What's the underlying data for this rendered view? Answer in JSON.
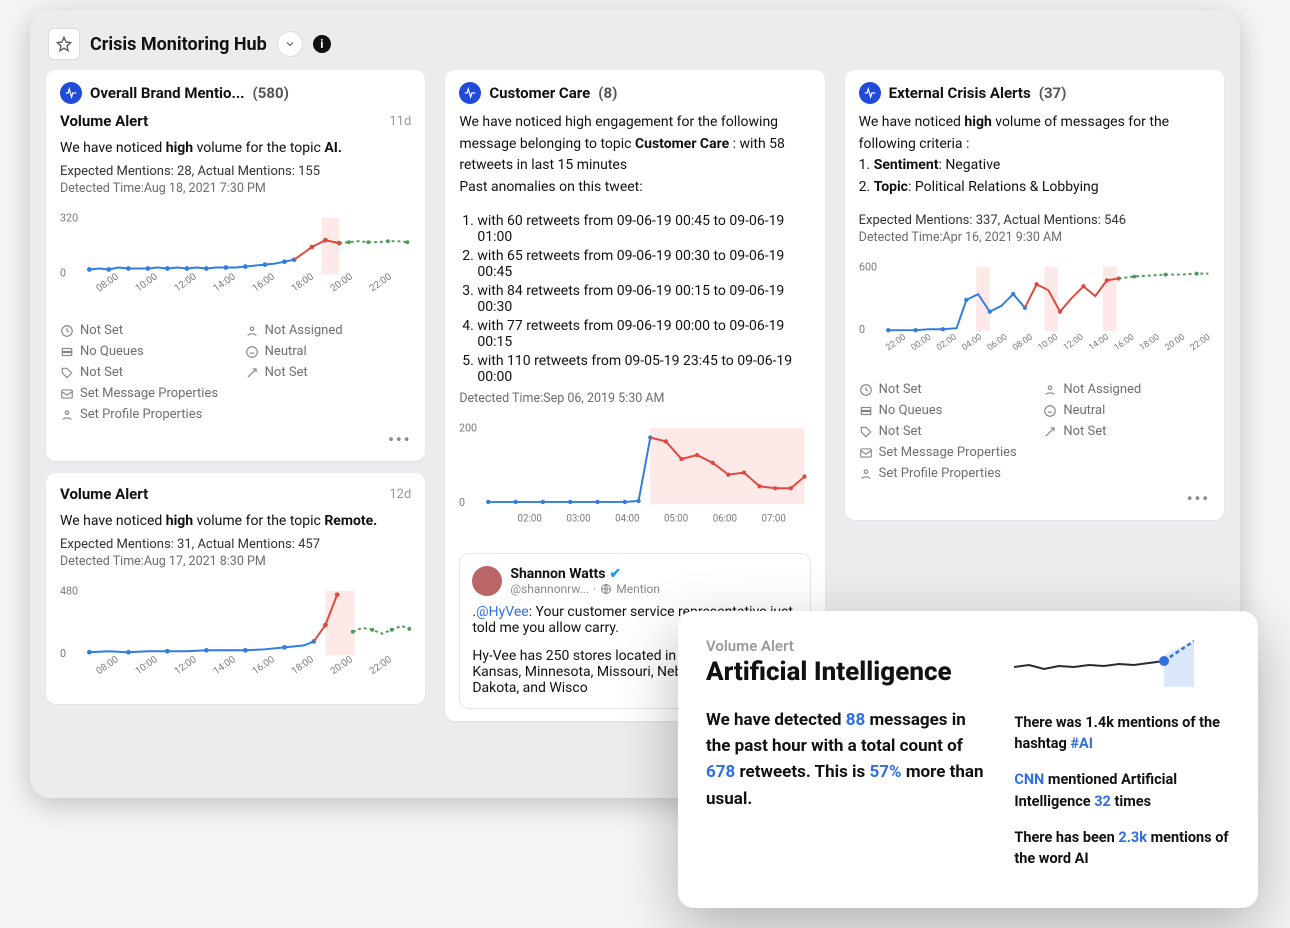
{
  "page": {
    "title": "Crisis Monitoring Hub"
  },
  "columns": {
    "left": {
      "header": {
        "title": "Overall Brand Mentio...",
        "count": "(580)"
      },
      "card1": {
        "title": "Volume Alert",
        "age": "11d",
        "line1_prefix": "We have noticed ",
        "line1_bold1": "high",
        "line1_mid": " volume for the topic ",
        "line1_bold2": "AI.",
        "meta": "Expected Mentions: 28, Actual Mentions: 155",
        "detected": "Detected Time:Aug 18, 2021 7:30 PM"
      },
      "card2": {
        "title": "Volume Alert",
        "age": "12d",
        "line1_prefix": "We have noticed ",
        "line1_bold1": "high",
        "line1_mid": " volume for the topic ",
        "line1_bold2": "Remote.",
        "meta": "Expected Mentions: 31, Actual Mentions: 457",
        "detected": "Detected Time:Aug 17, 2021 8:30 PM"
      }
    },
    "mid": {
      "header": {
        "title": "Customer Care",
        "count": "(8)"
      },
      "intro_prefix": "We have noticed high engagement for the following message belonging to topic ",
      "intro_bold": "Customer Care",
      "intro_suffix": " :  with 58 retweets in last 15 minutes",
      "past_line": "Past anomalies on this tweet:",
      "items": [
        "with 60 retweets from 09-06-19 00:45 to 09-06-19 01:00",
        "with 65 retweets from 09-06-19 00:30 to 09-06-19 00:45",
        "with 84 retweets from 09-06-19 00:15 to 09-06-19 00:30",
        "with 77 retweets from 09-06-19 00:00 to 09-06-19 00:15",
        "with 110 retweets from 09-05-19 23:45 to 09-06-19 00:00"
      ],
      "detected": "Detected Time:Sep 06, 2019 5:30 AM",
      "tweet": {
        "name": "Shannon Watts",
        "handle": "@shannonrw...",
        "source": "Mention",
        "line1_prefix": ".",
        "line1_blue": "@HyVee",
        "line1_suffix": ": Your customer service representative just told me you allow",
        "line1_tail": " carry.",
        "line2": "Hy-Vee has 250 stores located in Iowa, Illinois, Kansas, Minnesota, Missouri, Nebraska, South Dakota, and Wisco"
      }
    },
    "right": {
      "header": {
        "title": "External Crisis Alerts",
        "count": "(37)"
      },
      "intro_prefix": "We have noticed ",
      "intro_bold": "high",
      "intro_suffix": " volume of messages for the following criteria :",
      "crit1_label": "Sentiment",
      "crit1_val": ": Negative",
      "crit2_label": "Topic",
      "crit2_val": ": Political Relations & Lobbying",
      "meta": "Expected Mentions: 337, Actual Mentions: 546",
      "detected": "Detected Time:Apr 16, 2021 9:30 AM"
    }
  },
  "props": {
    "notset": "Not Set",
    "noqueues": "No Queues",
    "notassigned": "Not Assigned",
    "neutral": "Neutral",
    "setmsg": "Set Message Properties",
    "setprof": "Set Profile Properties"
  },
  "chart_data": [
    {
      "id": "left1",
      "type": "line",
      "xlabel": "",
      "ylabel": "",
      "categories_ticks": [
        "08:00",
        "10:00",
        "12:00",
        "14:00",
        "16:00",
        "18:00",
        "20:00",
        "22:00"
      ],
      "x": [
        "07:30",
        "08:00",
        "08:30",
        "09:00",
        "09:30",
        "10:00",
        "10:30",
        "11:00",
        "11:30",
        "12:00",
        "12:30",
        "13:00",
        "13:30",
        "14:00",
        "14:30",
        "15:00",
        "15:30",
        "16:00",
        "16:30",
        "17:00",
        "17:30",
        "18:00",
        "18:30",
        "19:00",
        "19:30",
        "20:00",
        "20:30",
        "21:00",
        "21:30",
        "22:00",
        "22:30",
        "23:00"
      ],
      "series": [
        {
          "name": "actual-low",
          "color": "#2f7de1",
          "style": "solid",
          "values": [
            28,
            30,
            28,
            32,
            30,
            30,
            30,
            32,
            30,
            34,
            32,
            32,
            34,
            30,
            34,
            32,
            34,
            34,
            36,
            40,
            44,
            50,
            null,
            null,
            null,
            null,
            null,
            null,
            null,
            null,
            null,
            null
          ]
        },
        {
          "name": "spike",
          "color": "#e0483e",
          "style": "solid",
          "values": [
            null,
            null,
            null,
            null,
            null,
            null,
            null,
            null,
            null,
            null,
            null,
            null,
            null,
            null,
            null,
            null,
            null,
            null,
            null,
            null,
            null,
            50,
            110,
            155,
            135,
            null,
            null,
            null,
            null,
            null,
            null,
            null
          ]
        },
        {
          "name": "forecast",
          "color": "#4f9a57",
          "style": "dashed",
          "values": [
            null,
            null,
            null,
            null,
            null,
            null,
            null,
            null,
            null,
            null,
            null,
            null,
            null,
            null,
            null,
            null,
            null,
            null,
            null,
            null,
            null,
            null,
            null,
            null,
            135,
            140,
            142,
            140,
            138,
            140,
            142,
            140
          ]
        }
      ],
      "ylim": [
        0,
        320
      ],
      "yticks": [
        0,
        320
      ],
      "shaded_x": [
        "19:00",
        "19:30"
      ]
    },
    {
      "id": "left2",
      "type": "line",
      "categories_ticks": [
        "08:00",
        "10:00",
        "12:00",
        "14:00",
        "16:00",
        "18:00",
        "20:00",
        "22:00"
      ],
      "x": [
        "07:30",
        "08:00",
        "08:30",
        "09:00",
        "09:30",
        "10:00",
        "10:30",
        "11:00",
        "11:30",
        "12:00",
        "12:30",
        "13:00",
        "13:30",
        "14:00",
        "14:30",
        "15:00",
        "15:30",
        "16:00",
        "16:30",
        "17:00",
        "17:30",
        "18:00",
        "18:30",
        "19:00",
        "19:30",
        "20:00",
        "20:30",
        "21:00",
        "21:30",
        "22:00",
        "22:30",
        "23:00"
      ],
      "series": [
        {
          "name": "actual-low",
          "color": "#2f7de1",
          "style": "solid",
          "values": [
            30,
            34,
            30,
            36,
            32,
            34,
            32,
            36,
            34,
            40,
            36,
            36,
            38,
            34,
            40,
            36,
            38,
            36,
            40,
            42,
            48,
            56,
            70,
            null,
            null,
            null,
            null,
            null,
            null,
            null,
            null,
            null
          ]
        },
        {
          "name": "spike",
          "color": "#e0483e",
          "style": "solid",
          "values": [
            null,
            null,
            null,
            null,
            null,
            null,
            null,
            null,
            null,
            null,
            null,
            null,
            null,
            null,
            null,
            null,
            null,
            null,
            null,
            null,
            null,
            null,
            70,
            260,
            457,
            null,
            null,
            null,
            null,
            null,
            null,
            null
          ]
        },
        {
          "name": "forecast",
          "color": "#4f9a57",
          "style": "dashed",
          "values": [
            null,
            null,
            null,
            null,
            null,
            null,
            null,
            null,
            null,
            null,
            null,
            null,
            null,
            null,
            null,
            null,
            null,
            null,
            null,
            null,
            null,
            null,
            null,
            null,
            null,
            160,
            180,
            170,
            150,
            170,
            190,
            175
          ]
        }
      ],
      "ylim": [
        0,
        480
      ],
      "yticks": [
        0,
        480
      ],
      "shaded_x": [
        "19:30",
        "20:30"
      ]
    },
    {
      "id": "mid",
      "type": "line",
      "categories_ticks": [
        "02:00",
        "03:00",
        "04:00",
        "05:00",
        "06:00",
        "07:00"
      ],
      "x": [
        "01:30",
        "01:45",
        "02:00",
        "02:15",
        "02:30",
        "02:45",
        "03:00",
        "03:15",
        "03:30",
        "03:45",
        "04:00",
        "04:15",
        "04:30",
        "04:45",
        "05:00",
        "05:15",
        "05:30",
        "05:45",
        "06:00",
        "06:15",
        "06:30",
        "06:45",
        "07:00",
        "07:15",
        "07:30"
      ],
      "series": [
        {
          "name": "baseline",
          "color": "#2f7de1",
          "style": "solid",
          "values": [
            6,
            6,
            6,
            6,
            6,
            6,
            6,
            6,
            6,
            6,
            6,
            6,
            6,
            8,
            170,
            null,
            null,
            null,
            null,
            null,
            null,
            null,
            null,
            null,
            null
          ]
        },
        {
          "name": "decay",
          "color": "#e0483e",
          "style": "solid",
          "values": [
            null,
            null,
            null,
            null,
            null,
            null,
            null,
            null,
            null,
            null,
            null,
            null,
            null,
            null,
            170,
            160,
            120,
            130,
            110,
            85,
            90,
            60,
            55,
            55,
            70
          ]
        }
      ],
      "ylim": [
        0,
        200
      ],
      "yticks": [
        0,
        200
      ],
      "shaded_x": [
        "05:00",
        "07:30"
      ]
    },
    {
      "id": "right",
      "type": "line",
      "categories_ticks": [
        "22:00",
        "00:00",
        "02:00",
        "04:00",
        "06:00",
        "08:00",
        "10:00",
        "12:00",
        "14:00",
        "16:00",
        "18:00",
        "20:00",
        "22:00"
      ],
      "x": [
        "21:00",
        "22:00",
        "23:00",
        "00:00",
        "01:00",
        "02:00",
        "03:00",
        "04:00",
        "05:00",
        "06:00",
        "07:00",
        "08:00",
        "09:00",
        "10:00",
        "11:00",
        "12:00",
        "13:00",
        "14:00",
        "15:00",
        "16:00",
        "17:00",
        "18:00",
        "19:00",
        "20:00",
        "21:00",
        "22:00",
        "23:00"
      ],
      "series": [
        {
          "name": "blue",
          "color": "#2f7de1",
          "style": "solid",
          "values": [
            40,
            40,
            40,
            45,
            45,
            50,
            280,
            350,
            210,
            270,
            380,
            260,
            null,
            null,
            null,
            null,
            null,
            null,
            null,
            null,
            null,
            null,
            null,
            null,
            null,
            null,
            null
          ]
        },
        {
          "name": "red",
          "color": "#e0483e",
          "style": "solid",
          "values": [
            null,
            null,
            null,
            null,
            null,
            null,
            null,
            null,
            null,
            null,
            null,
            260,
            470,
            420,
            240,
            350,
            440,
            370,
            490,
            520,
            null,
            null,
            null,
            null,
            null,
            null,
            null
          ]
        },
        {
          "name": "green",
          "color": "#4f9a57",
          "style": "dashed",
          "values": [
            null,
            null,
            null,
            null,
            null,
            null,
            null,
            null,
            null,
            null,
            null,
            null,
            null,
            null,
            null,
            null,
            null,
            null,
            null,
            520,
            540,
            550,
            550,
            560,
            560,
            560,
            565
          ]
        }
      ],
      "ylim": [
        0,
        600
      ],
      "yticks": [
        0,
        600
      ],
      "shaded_x_multi": [
        [
          "07:00",
          "08:00"
        ],
        [
          "12:00",
          "13:00"
        ],
        [
          "17:00",
          "18:00"
        ]
      ]
    },
    {
      "id": "spark",
      "type": "line",
      "x": [
        0,
        1,
        2,
        3,
        4,
        5,
        6,
        7,
        8,
        9,
        10,
        11,
        12
      ],
      "series": [
        {
          "name": "mentions",
          "color": "#222",
          "values": [
            22,
            24,
            20,
            23,
            22,
            24,
            23,
            25,
            24,
            26,
            25,
            30,
            48
          ]
        }
      ],
      "highlight_point": {
        "x": 10,
        "color": "#2f6fe0"
      },
      "ylim": [
        0,
        50
      ]
    }
  ],
  "overlay": {
    "kicker": "Volume Alert",
    "title": "Artificial Intelligence",
    "body_p1": "We have detected ",
    "body_n1": "88",
    "body_p2": " messages in the past hour with a total count of ",
    "body_n2": "678",
    "body_p3": " retweets. This is ",
    "body_n3": "57%",
    "body_p4": " more than usual.",
    "right_1a": "There was 1.4k mentions of the hashtag ",
    "right_1b": "#AI",
    "right_2a": "CNN",
    "right_2b": " mentioned Artificial Intelligence ",
    "right_2c": "32",
    "right_2d": " times",
    "right_3a": "There has been ",
    "right_3b": "2.3k",
    "right_3c": " mentions of the word AI"
  }
}
